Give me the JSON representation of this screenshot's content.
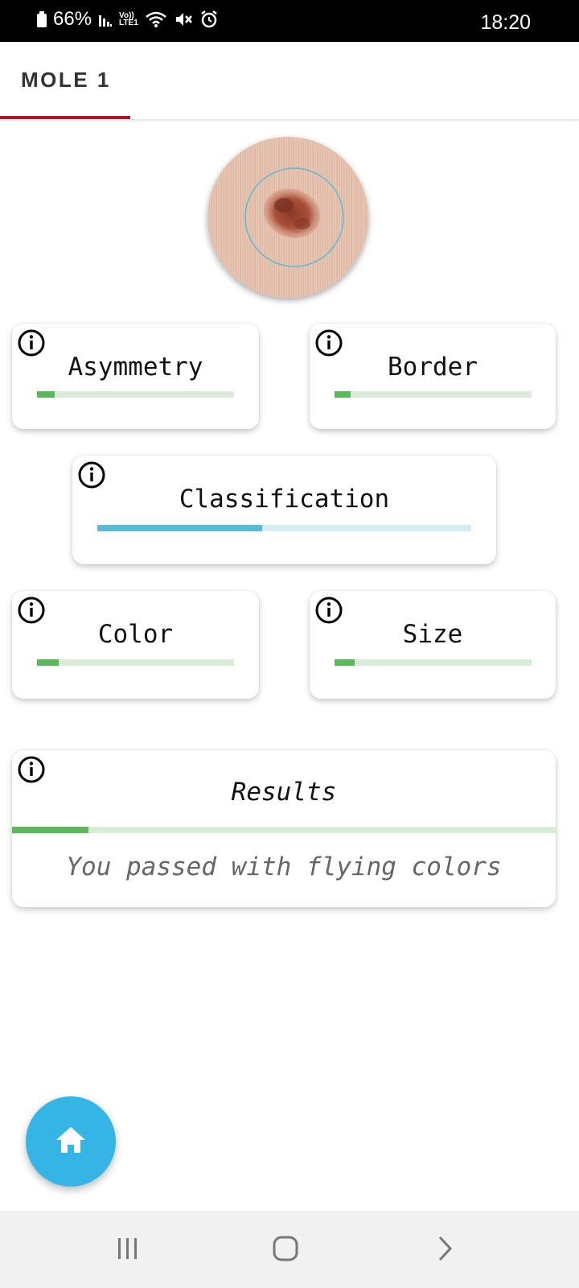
{
  "status_bar": {
    "battery_percent": "66%",
    "time": "18:20",
    "network_label_top": "Vo))",
    "network_label_bottom": "LTE1",
    "icons": [
      "battery-icon",
      "signal-icon",
      "volte-icon",
      "wifi-icon",
      "mute-icon",
      "alarm-icon"
    ]
  },
  "tabs": [
    {
      "label": "MOLE 1",
      "selected": true
    }
  ],
  "mole_image": {
    "icon": "mole-photo",
    "accent": "#5bbad5"
  },
  "cards": {
    "asymmetry": {
      "title": "Asymmetry",
      "progress": 0.09
    },
    "border": {
      "title": "Border",
      "progress": 0.08
    },
    "classification": {
      "title": "Classification",
      "progress": 0.44
    },
    "color": {
      "title": "Color",
      "progress": 0.11
    },
    "size": {
      "title": "Size",
      "progress": 0.1
    }
  },
  "results": {
    "title": "Results",
    "progress": 0.14,
    "message": "You passed with flying colors"
  },
  "fab": {
    "icon": "home-icon",
    "color": "#35b5e5"
  },
  "nav_bar": {
    "icons": [
      "recent-apps-icon",
      "home-nav-icon",
      "back-icon"
    ]
  },
  "colors": {
    "tab_indicator": "#b0182a",
    "progress_green": "#5cb85c",
    "progress_blue": "#5bbad5"
  }
}
